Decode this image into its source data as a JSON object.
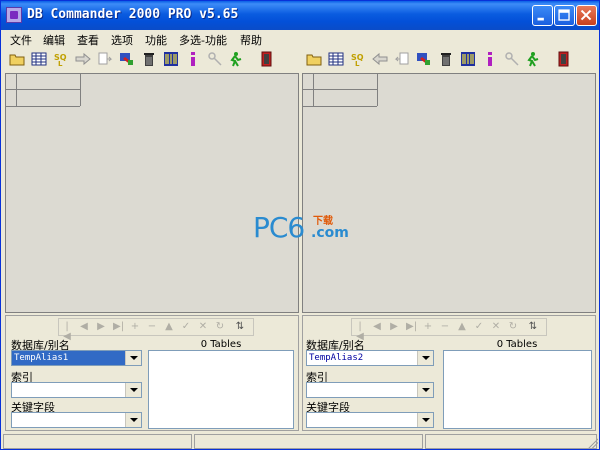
{
  "window": {
    "title": "DB Commander 2000 PRO v5.65"
  },
  "menu": {
    "items": [
      {
        "label": "文件"
      },
      {
        "label": "编辑"
      },
      {
        "label": "查看"
      },
      {
        "label": "选项"
      },
      {
        "label": "功能"
      },
      {
        "label": "多选-功能"
      },
      {
        "label": "帮助"
      }
    ]
  },
  "toolbar_icons": [
    "open-folder-icon",
    "table-grid-icon",
    "sql-icon",
    "arrow-icon",
    "copy-doc-icon",
    "filter-tool-icon",
    "trash-icon",
    "barcode-icon",
    "info-icon",
    "key-wrench-icon",
    "run-icon",
    "exit-door-icon"
  ],
  "left_panel": {
    "db_label": "数据库/别名",
    "db_value": "TempAlias1",
    "index_label": "索引",
    "key_label": "关键字段",
    "tables_title": "0 Tables"
  },
  "right_panel": {
    "db_label": "数据库/别名",
    "db_value": "TempAlias2",
    "index_label": "索引",
    "key_label": "关键字段",
    "tables_title": "0 Tables"
  },
  "watermark": {
    "brand": "PC6",
    "download": "下载",
    "domain": ".com"
  },
  "colors": {
    "title_blue": "#0a5ce0",
    "selection": "#316ac5",
    "face": "#ece9d8"
  }
}
